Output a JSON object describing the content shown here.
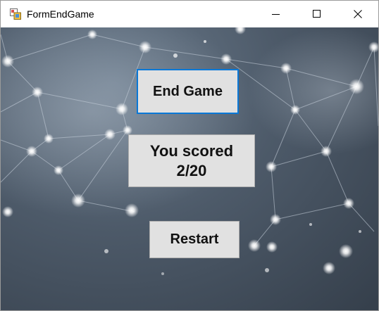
{
  "window": {
    "title": "FormEndGame",
    "icons": {
      "app": "form-app-icon",
      "minimize": "minimize-icon",
      "maximize": "maximize-icon",
      "close": "close-icon"
    }
  },
  "main": {
    "end_game_label": "End Game",
    "score_line1": "You scored",
    "score_value": "2/20",
    "restart_label": "Restart"
  },
  "colors": {
    "focus_border": "#0a78d7",
    "button_face": "#e1e1e1",
    "background_dark": "#353f4b",
    "background_light": "#6b7b8c"
  }
}
